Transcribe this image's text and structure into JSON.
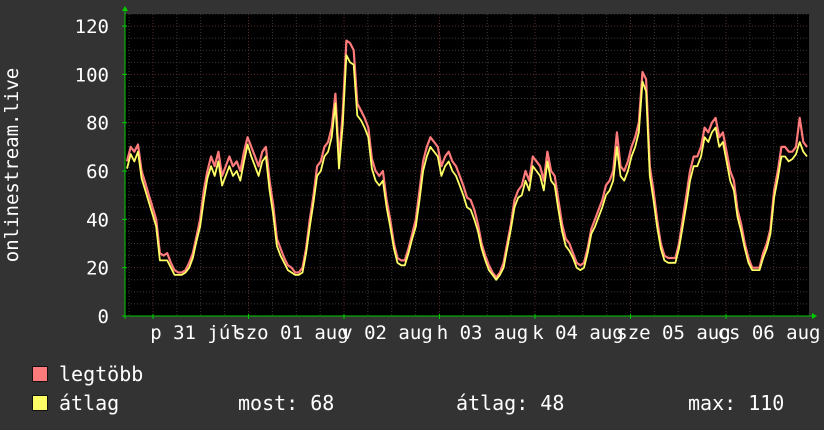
{
  "chart_data": {
    "type": "line",
    "ylabel": "onlinestream.live",
    "ylim": [
      0,
      125
    ],
    "yticks": [
      0,
      20,
      40,
      60,
      80,
      100,
      120
    ],
    "x_tick_labels": [
      "p 31 júl",
      "szo 01 aug",
      "v 02 aug",
      "h 03 aug",
      "k 04 aug",
      "sze 05 aug",
      "cs 06 aug"
    ],
    "grid": true,
    "legend_position": "bottom",
    "colors": {
      "background": "#333333",
      "plot": "#000000",
      "grid_major": "#5a2a2a",
      "grid_minor": "#3a3a3a",
      "axis": "#00cc00",
      "max": "#ff7a7a",
      "avg": "#ffff66"
    },
    "series": [
      {
        "name": "legtöbb",
        "values": [
          64,
          70,
          68,
          71,
          60,
          55,
          50,
          45,
          40,
          26,
          25,
          26,
          22,
          19,
          18,
          18,
          19,
          22,
          26,
          33,
          40,
          52,
          60,
          66,
          62,
          68,
          58,
          62,
          66,
          62,
          64,
          60,
          68,
          74,
          70,
          66,
          62,
          68,
          70,
          56,
          46,
          32,
          28,
          24,
          21,
          20,
          18,
          18,
          20,
          28,
          40,
          50,
          62,
          64,
          70,
          72,
          78,
          92,
          65,
          84,
          114,
          113,
          110,
          88,
          85,
          82,
          78,
          65,
          60,
          58,
          60,
          48,
          40,
          30,
          24,
          23,
          23,
          28,
          34,
          40,
          52,
          64,
          70,
          74,
          72,
          70,
          62,
          66,
          68,
          64,
          62,
          58,
          54,
          49,
          48,
          44,
          38,
          30,
          25,
          21,
          18,
          16,
          18,
          22,
          30,
          38,
          48,
          52,
          54,
          60,
          56,
          66,
          64,
          62,
          56,
          68,
          60,
          58,
          48,
          38,
          32,
          30,
          26,
          22,
          21,
          22,
          28,
          36,
          40,
          44,
          48,
          54,
          56,
          60,
          76,
          62,
          60,
          64,
          70,
          74,
          80,
          101,
          98,
          62,
          52,
          40,
          30,
          25,
          24,
          24,
          24,
          30,
          40,
          50,
          60,
          66,
          66,
          70,
          78,
          76,
          80,
          82,
          74,
          76,
          68,
          60,
          56,
          44,
          38,
          30,
          24,
          20,
          20,
          20,
          26,
          30,
          36,
          52,
          60,
          70,
          70,
          68,
          68,
          70,
          82,
          72,
          70
        ]
      },
      {
        "name": "átlag",
        "values": [
          61,
          67,
          64,
          68,
          57,
          52,
          47,
          42,
          37,
          23,
          23,
          23,
          20,
          17,
          17,
          17,
          18,
          20,
          24,
          31,
          37,
          48,
          57,
          62,
          58,
          64,
          54,
          58,
          62,
          58,
          60,
          56,
          64,
          71,
          66,
          62,
          58,
          64,
          66,
          52,
          42,
          29,
          25,
          22,
          19,
          18,
          17,
          17,
          18,
          26,
          37,
          47,
          58,
          60,
          66,
          68,
          74,
          88,
          61,
          79,
          108,
          105,
          104,
          83,
          81,
          78,
          74,
          61,
          56,
          54,
          56,
          45,
          37,
          28,
          22,
          21,
          21,
          26,
          32,
          37,
          48,
          60,
          66,
          70,
          68,
          66,
          58,
          62,
          64,
          60,
          58,
          54,
          50,
          45,
          44,
          40,
          35,
          28,
          23,
          19,
          17,
          15,
          17,
          20,
          28,
          36,
          45,
          49,
          50,
          56,
          52,
          62,
          60,
          58,
          52,
          64,
          56,
          54,
          44,
          35,
          29,
          27,
          24,
          20,
          19,
          20,
          26,
          34,
          37,
          41,
          45,
          50,
          52,
          56,
          70,
          58,
          56,
          60,
          66,
          70,
          76,
          97,
          93,
          58,
          48,
          37,
          28,
          23,
          22,
          22,
          22,
          28,
          37,
          46,
          56,
          62,
          62,
          66,
          74,
          72,
          76,
          78,
          70,
          72,
          64,
          56,
          52,
          41,
          35,
          28,
          22,
          19,
          19,
          19,
          24,
          28,
          34,
          49,
          57,
          66,
          66,
          64,
          65,
          67,
          72,
          68,
          66
        ]
      }
    ]
  },
  "legend": {
    "items": [
      {
        "label": "legtöbb",
        "color": "#ff7a7a"
      },
      {
        "label": "átlag",
        "color": "#ffff66"
      }
    ],
    "stats": {
      "most": "most: 68",
      "atlag": "átlag: 48",
      "max": "max: 110"
    }
  }
}
